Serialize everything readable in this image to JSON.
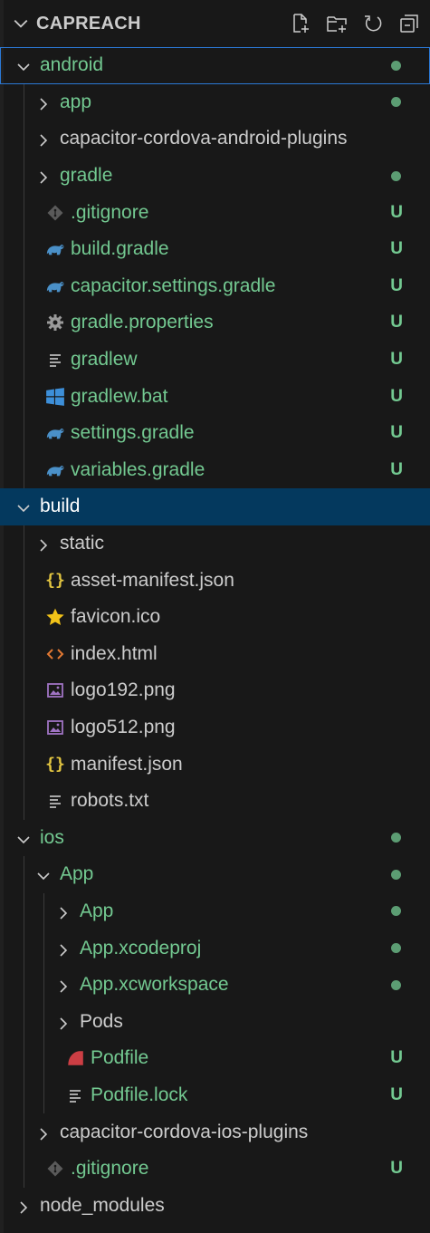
{
  "explorer": {
    "title": "CAPREACH",
    "actions": [
      {
        "name": "new-file-icon"
      },
      {
        "name": "new-folder-icon"
      },
      {
        "name": "refresh-icon"
      },
      {
        "name": "collapse-all-icon"
      }
    ]
  },
  "tree": [
    {
      "label": "android",
      "depth": 0,
      "kind": "folder-open",
      "color": "green",
      "status": "dot",
      "focused": true
    },
    {
      "label": "app",
      "depth": 1,
      "kind": "folder-closed",
      "color": "green",
      "status": "dot"
    },
    {
      "label": "capacitor-cordova-android-plugins",
      "depth": 1,
      "kind": "folder-closed",
      "color": "gray",
      "status": ""
    },
    {
      "label": "gradle",
      "depth": 1,
      "kind": "folder-closed",
      "color": "green",
      "status": "dot"
    },
    {
      "label": ".gitignore",
      "depth": 1,
      "kind": "file",
      "icon": "git-icon",
      "color": "green",
      "status": "U"
    },
    {
      "label": "build.gradle",
      "depth": 1,
      "kind": "file",
      "icon": "gradle-icon",
      "color": "green",
      "status": "U"
    },
    {
      "label": "capacitor.settings.gradle",
      "depth": 1,
      "kind": "file",
      "icon": "gradle-icon",
      "color": "green",
      "status": "U"
    },
    {
      "label": "gradle.properties",
      "depth": 1,
      "kind": "file",
      "icon": "gear-icon",
      "color": "green",
      "status": "U"
    },
    {
      "label": "gradlew",
      "depth": 1,
      "kind": "file",
      "icon": "text-file-icon",
      "color": "green",
      "status": "U"
    },
    {
      "label": "gradlew.bat",
      "depth": 1,
      "kind": "file",
      "icon": "windows-icon",
      "color": "green",
      "status": "U"
    },
    {
      "label": "settings.gradle",
      "depth": 1,
      "kind": "file",
      "icon": "gradle-icon",
      "color": "green",
      "status": "U"
    },
    {
      "label": "variables.gradle",
      "depth": 1,
      "kind": "file",
      "icon": "gradle-icon",
      "color": "green",
      "status": "U"
    },
    {
      "label": "build",
      "depth": 0,
      "kind": "folder-open",
      "color": "white",
      "status": "",
      "selected": true
    },
    {
      "label": "static",
      "depth": 1,
      "kind": "folder-closed",
      "color": "gray",
      "status": ""
    },
    {
      "label": "asset-manifest.json",
      "depth": 1,
      "kind": "file",
      "icon": "json-icon",
      "color": "gray",
      "status": ""
    },
    {
      "label": "favicon.ico",
      "depth": 1,
      "kind": "file",
      "icon": "star-icon",
      "color": "gray",
      "status": ""
    },
    {
      "label": "index.html",
      "depth": 1,
      "kind": "file",
      "icon": "html-icon",
      "color": "gray",
      "status": ""
    },
    {
      "label": "logo192.png",
      "depth": 1,
      "kind": "file",
      "icon": "image-icon",
      "color": "gray",
      "status": ""
    },
    {
      "label": "logo512.png",
      "depth": 1,
      "kind": "file",
      "icon": "image-icon",
      "color": "gray",
      "status": ""
    },
    {
      "label": "manifest.json",
      "depth": 1,
      "kind": "file",
      "icon": "json-icon",
      "color": "gray",
      "status": ""
    },
    {
      "label": "robots.txt",
      "depth": 1,
      "kind": "file",
      "icon": "text-file-icon",
      "color": "gray",
      "status": ""
    },
    {
      "label": "ios",
      "depth": 0,
      "kind": "folder-open",
      "color": "green",
      "status": "dot"
    },
    {
      "label": "App",
      "depth": 1,
      "kind": "folder-open",
      "color": "green",
      "status": "dot"
    },
    {
      "label": "App",
      "depth": 2,
      "kind": "folder-closed",
      "color": "green",
      "status": "dot"
    },
    {
      "label": "App.xcodeproj",
      "depth": 2,
      "kind": "folder-closed",
      "color": "green",
      "status": "dot"
    },
    {
      "label": "App.xcworkspace",
      "depth": 2,
      "kind": "folder-closed",
      "color": "green",
      "status": "dot"
    },
    {
      "label": "Pods",
      "depth": 2,
      "kind": "folder-closed",
      "color": "gray",
      "status": ""
    },
    {
      "label": "Podfile",
      "depth": 2,
      "kind": "file",
      "icon": "ruby-icon",
      "color": "green",
      "status": "U"
    },
    {
      "label": "Podfile.lock",
      "depth": 2,
      "kind": "file",
      "icon": "text-file-icon",
      "color": "green",
      "status": "U"
    },
    {
      "label": "capacitor-cordova-ios-plugins",
      "depth": 1,
      "kind": "folder-closed",
      "color": "gray",
      "status": ""
    },
    {
      "label": ".gitignore",
      "depth": 1,
      "kind": "file",
      "icon": "git-icon",
      "color": "green",
      "status": "U"
    },
    {
      "label": "node_modules",
      "depth": 0,
      "kind": "folder-closed",
      "color": "gray",
      "status": ""
    }
  ],
  "colors": {
    "background": "#181818",
    "selected": "#04395e",
    "focus_border": "#2b79d6",
    "untracked_green": "#73c991",
    "text": "#cccccc"
  }
}
